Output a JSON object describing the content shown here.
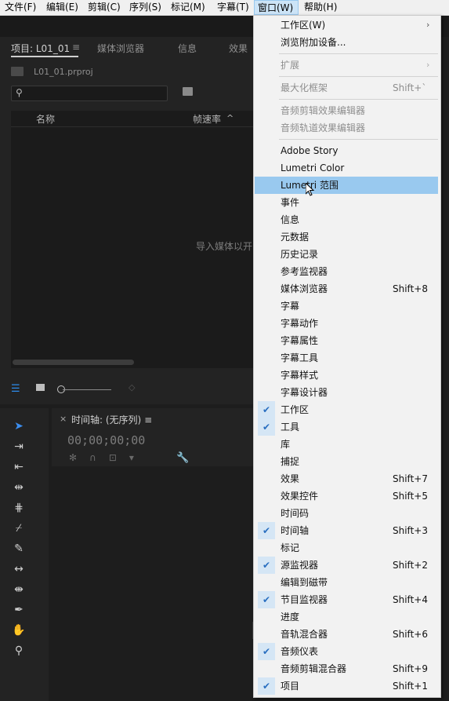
{
  "menubar": {
    "items": [
      {
        "label": "文件(F)"
      },
      {
        "label": "编辑(E)"
      },
      {
        "label": "剪辑(C)"
      },
      {
        "label": "序列(S)"
      },
      {
        "label": "标记(M)"
      },
      {
        "label": "字幕(T)"
      },
      {
        "label": "窗口(W)"
      },
      {
        "label": "帮助(H)"
      }
    ]
  },
  "project_panel": {
    "tabs": [
      {
        "label": "项目: L01_01"
      },
      {
        "label": "≡"
      },
      {
        "label": "媒体浏览器"
      },
      {
        "label": "信息"
      },
      {
        "label": "效果"
      }
    ],
    "file_name": "L01_01.prproj",
    "search_placeholder": "",
    "columns": {
      "name": "名称",
      "frame_rate": "帧速率",
      "sort_arrow": "^"
    },
    "empty_message": "导入媒体以开"
  },
  "timeline_panel": {
    "close": "×",
    "title": "时间轴: (无序列)",
    "menu": "≡",
    "timecode": "00;00;00;00"
  },
  "window_menu": {
    "items": [
      {
        "label": "工作区(W)",
        "has_submenu": true,
        "disabled": false
      },
      {
        "label": "浏览附加设备...",
        "disabled": false
      },
      {
        "label": "扩展",
        "has_submenu": true,
        "disabled": true
      },
      {
        "label": "最大化框架",
        "shortcut": "Shift+`",
        "disabled": true
      },
      {
        "label": "音频剪辑效果编辑器",
        "disabled": true
      },
      {
        "label": "音频轨道效果编辑器",
        "disabled": true
      },
      {
        "label": "Adobe Story"
      },
      {
        "label": "Lumetri Color"
      },
      {
        "label": "Lumetri 范围",
        "highlighted": true
      },
      {
        "label": "事件"
      },
      {
        "label": "信息"
      },
      {
        "label": "元数据"
      },
      {
        "label": "历史记录"
      },
      {
        "label": "参考监视器"
      },
      {
        "label": "媒体浏览器",
        "shortcut": "Shift+8"
      },
      {
        "label": "字幕"
      },
      {
        "label": "字幕动作"
      },
      {
        "label": "字幕属性"
      },
      {
        "label": "字幕工具"
      },
      {
        "label": "字幕样式"
      },
      {
        "label": "字幕设计器"
      },
      {
        "label": "工作区",
        "checked": true
      },
      {
        "label": "工具",
        "checked": true
      },
      {
        "label": "库"
      },
      {
        "label": "捕捉"
      },
      {
        "label": "效果",
        "shortcut": "Shift+7"
      },
      {
        "label": "效果控件",
        "shortcut": "Shift+5"
      },
      {
        "label": "时间码"
      },
      {
        "label": "时间轴",
        "shortcut": "Shift+3",
        "checked": true
      },
      {
        "label": "标记"
      },
      {
        "label": "源监视器",
        "shortcut": "Shift+2",
        "checked": true
      },
      {
        "label": "编辑到磁带"
      },
      {
        "label": "节目监视器",
        "shortcut": "Shift+4",
        "checked": true
      },
      {
        "label": "进度"
      },
      {
        "label": "音轨混合器",
        "shortcut": "Shift+6"
      },
      {
        "label": "音频仪表",
        "checked": true
      },
      {
        "label": "音频剪辑混合器",
        "shortcut": "Shift+9"
      },
      {
        "label": "项目",
        "shortcut": "Shift+1",
        "checked": true
      }
    ]
  },
  "icons": {
    "check": "check-icon",
    "submenu": "chevron-right-icon",
    "cursor": "mouse-pointer-icon"
  },
  "colors": {
    "highlight": "#99c9ef",
    "check_bg": "#d5e6f5",
    "accent_blue": "#2d8ceb"
  }
}
